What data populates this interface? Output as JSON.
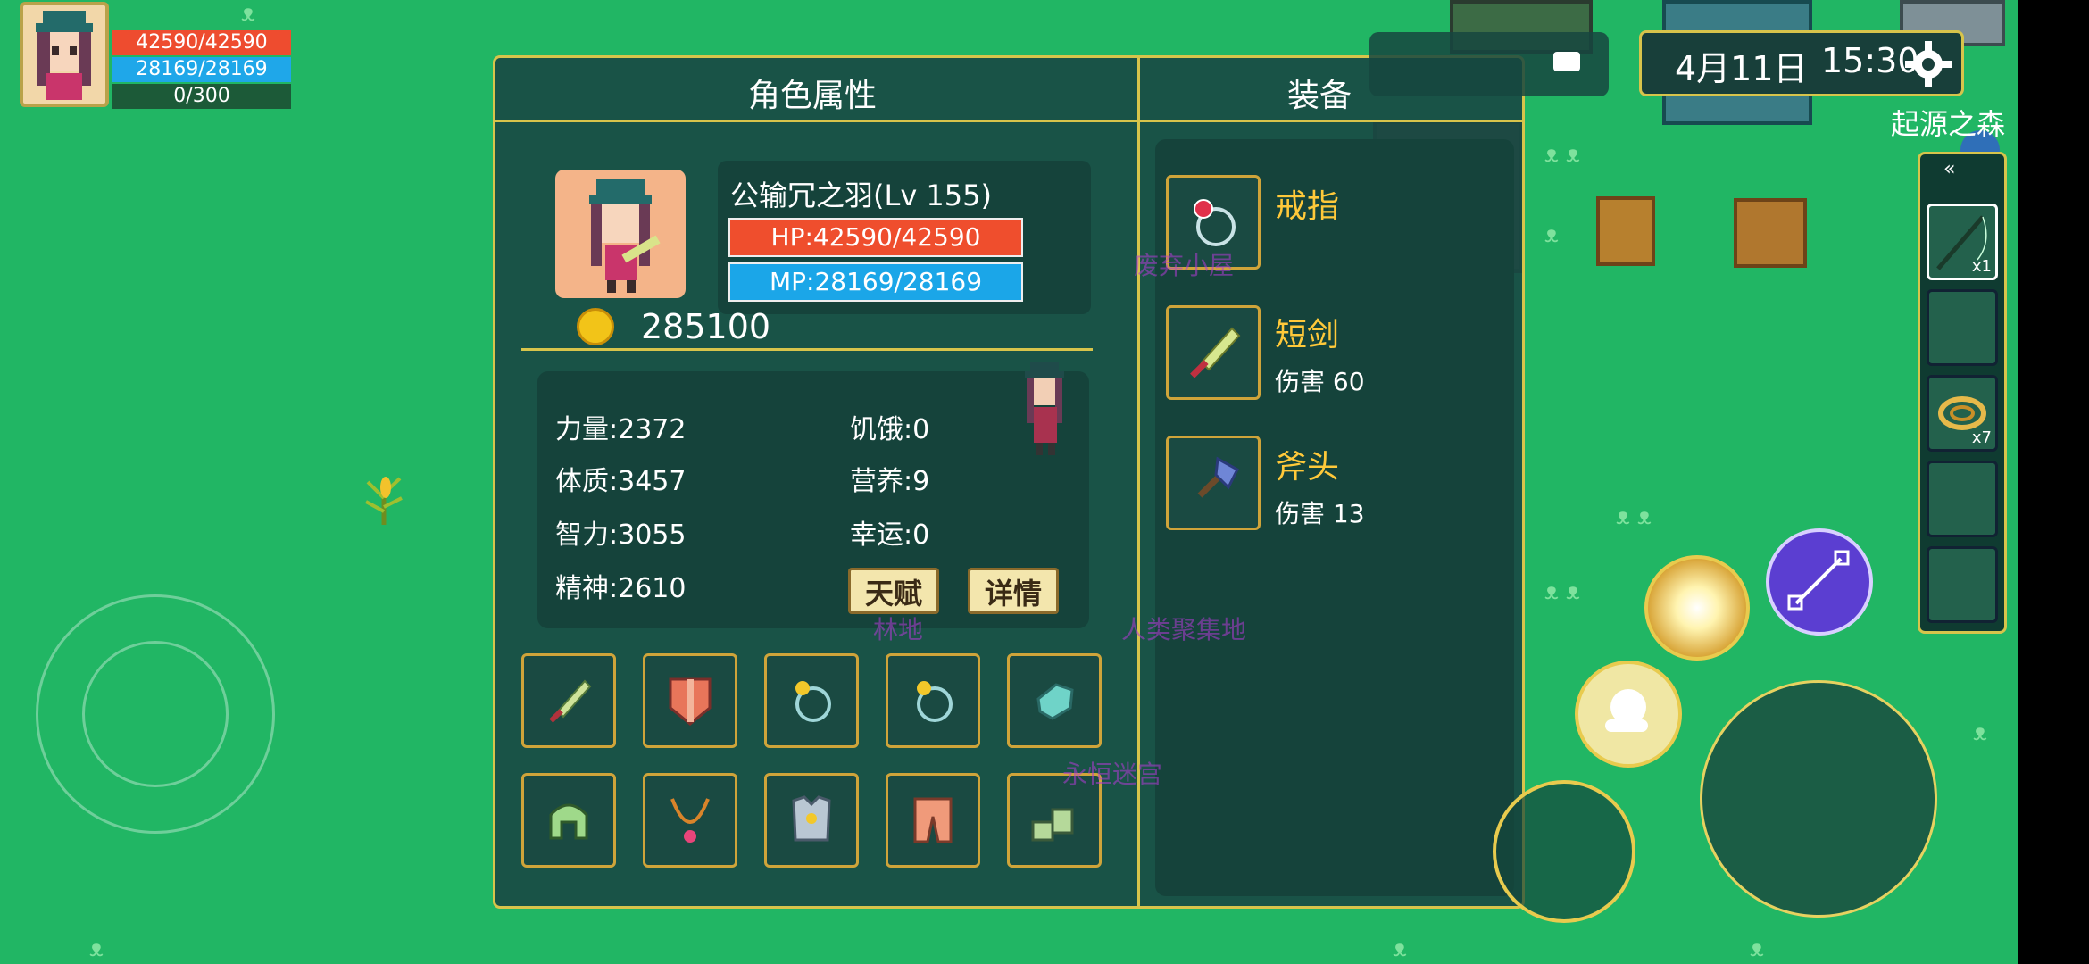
{
  "hud": {
    "hp": "42590/42590",
    "mp": "28169/28169",
    "xp": "0/300"
  },
  "panel": {
    "title_attributes": "角色属性",
    "title_equipment": "装备"
  },
  "character": {
    "name": "公输冗之羽(Lv 155)",
    "hp": "HP:42590/42590",
    "mp": "MP:28169/28169",
    "gold": "285100"
  },
  "stats": {
    "strength": "力量:2372",
    "constitution": "体质:3457",
    "intelligence": "智力:3055",
    "spirit": "精神:2610",
    "hunger": "饥饿:0",
    "nutrition": "营养:9",
    "luck": "幸运:0"
  },
  "buttons": {
    "talent": "天赋",
    "details": "详情"
  },
  "equipment_list": [
    {
      "name": "戒指",
      "sub": ""
    },
    {
      "name": "短剑",
      "sub": "伤害 60"
    },
    {
      "name": "斧头",
      "sub": "伤害 13"
    }
  ],
  "clock": {
    "date": "4月11日",
    "time": "15:30"
  },
  "area_name": "起源之森",
  "quickbar": {
    "slot1_count": "x1",
    "slot3_count": "x7"
  },
  "map_labels": [
    "废弃小屋",
    "林地",
    "人类聚集地",
    "永恒迷宫"
  ]
}
